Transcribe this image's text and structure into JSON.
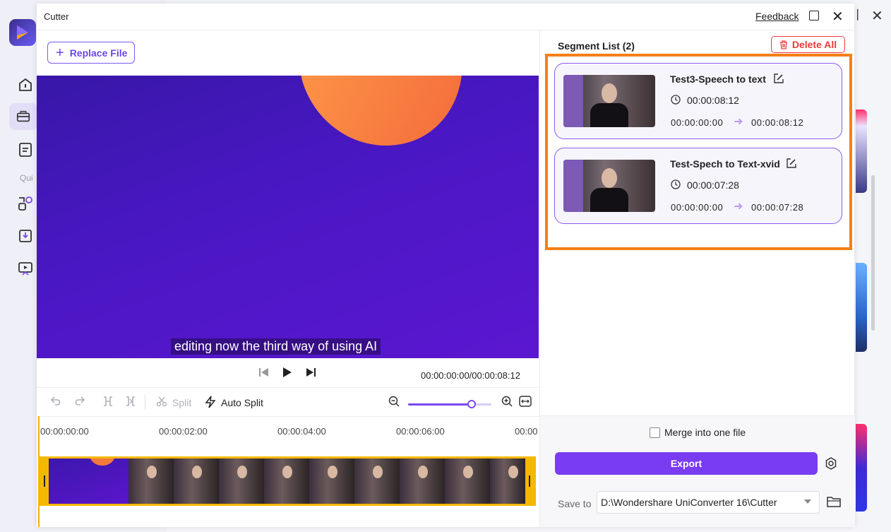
{
  "app": {
    "sidebar_label": "Qui"
  },
  "dialog": {
    "title": "Cutter",
    "feedback": "Feedback"
  },
  "player": {
    "replace_file": "Replace File",
    "subtitle": "editing now the third way of using AI",
    "timecode": "00:00:00:00/00:00:08:12"
  },
  "toolbar": {
    "split": "Split",
    "auto_split": "Auto Split",
    "zoom_level": 0.76
  },
  "timeline": {
    "ticks": [
      "00:00:00:00",
      "00:00:02:00",
      "00:00:04:00",
      "00:00:06:00",
      "00:00"
    ]
  },
  "segments": {
    "title": "Segment List (2)",
    "delete_all": "Delete All",
    "items": [
      {
        "name": "Test3-Speech to text",
        "duration": "00:00:08:12",
        "start": "00:00:00:00",
        "end": "00:00:08:12"
      },
      {
        "name": "Test-Spech to Text-xvid",
        "duration": "00:00:07:28",
        "start": "00:00:00:00",
        "end": "00:00:07:28"
      }
    ]
  },
  "export": {
    "merge_label": "Merge into one file",
    "merge_checked": false,
    "button": "Export",
    "save_to_label": "Save to",
    "save_path": "D:\\Wondershare UniConverter 16\\Cutter"
  },
  "colors": {
    "accent": "#7a3cf2",
    "highlight": "#f57f17",
    "danger": "#ec3b3b",
    "playhead": "#f5b800"
  }
}
